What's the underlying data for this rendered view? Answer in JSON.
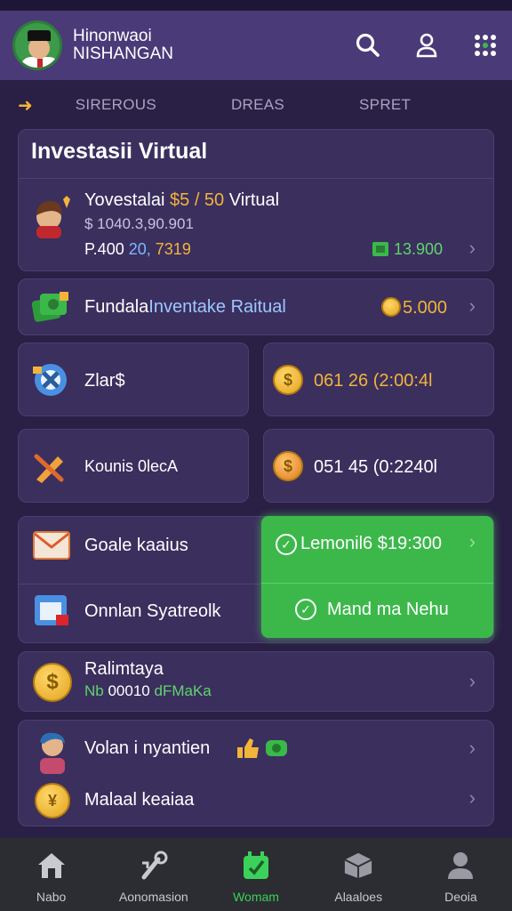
{
  "header": {
    "title_line1": "Hinonwaoi",
    "title_line2": "NISHANGAN"
  },
  "tabs": [
    {
      "label": "SIREROUS"
    },
    {
      "label": "DREAS"
    },
    {
      "label": "SPRET"
    }
  ],
  "investment_card": {
    "title": "Investasii Virtual",
    "row_name_prefix": "Yovestalai",
    "row_name_highlight": "$5 / 50",
    "row_name_suffix": "Virtual",
    "row_amount": "$ 1040.3,90.901",
    "row_values_prefix": "P.400",
    "row_values_blue": "20,",
    "row_values_orange": "7319",
    "row_right_value": "13.900"
  },
  "fund_row": {
    "label_prefix": "Fundala",
    "label_highlight": "Inventake Raitual",
    "value": "5.000"
  },
  "grid": {
    "item1_label": "Zlar$",
    "item2_value": "061 26 (2:00:4l",
    "item3_label": "Kounis 0lecA",
    "item4_value": "051 45 (0:2240l"
  },
  "lower_block": {
    "item1_label": "Goale kaaius",
    "item2_label": "Onnlan Syatreolk",
    "green_top_label": "Lemonil6 $19:300",
    "green_bottom_label": "Mand ma Nehu"
  },
  "payment_row": {
    "title": "Ralimtaya",
    "subtitle_green": "Nb",
    "subtitle_white": "00010",
    "subtitle_green2": "dFMaKa"
  },
  "last_card": {
    "row1_label": "Volan i nyantien",
    "row2_label": "Malaal keaiaa"
  },
  "bottom_nav": [
    {
      "label": "Nabo",
      "icon": "home-icon"
    },
    {
      "label": "Aonomasion",
      "icon": "tools-icon"
    },
    {
      "label": "Womam",
      "icon": "thumbs-up-icon"
    },
    {
      "label": "Alaaloes",
      "icon": "box-icon"
    },
    {
      "label": "Deoia",
      "icon": "profile-icon"
    }
  ],
  "colors": {
    "background": "#2a1f45",
    "header": "#4a3a78",
    "card": "#3b2f5e",
    "accent_green": "#3cb84b",
    "accent_orange": "#f2b43a"
  }
}
